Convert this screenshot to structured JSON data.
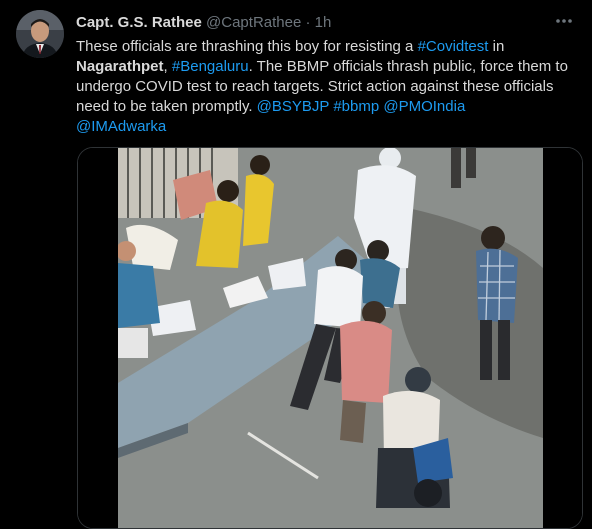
{
  "tweet": {
    "display_name": "Capt. G.S. Rathee",
    "handle": "@CaptRathee",
    "separator": "·",
    "time": "1h",
    "more_icon": "more-horizontal-icon",
    "text": {
      "p1": "These officials are thrashing this boy for resisting a ",
      "tag_covidtest": "#Covidtest",
      "p2": " in ",
      "place": "Nagarathpet",
      "p3": ", ",
      "tag_bengaluru": "#Bengaluru",
      "p4": ". The BBMP officials thrash public, force them to undergo COVID test to reach targets. Strict action against these officials need to be taken promptly. ",
      "mention_bsybjp": "@BSYBJP",
      "tag_bbmp": "#bbmp",
      "mention_pmoindia": "@PMOIndia",
      "mention_imadwarka": "@IMAdwarka"
    },
    "media": {
      "kind": "video-thumbnail"
    }
  },
  "colors": {
    "background": "#000000",
    "text": "#d9d9d9",
    "secondary": "#6e767d",
    "link": "#1d9bf0"
  }
}
